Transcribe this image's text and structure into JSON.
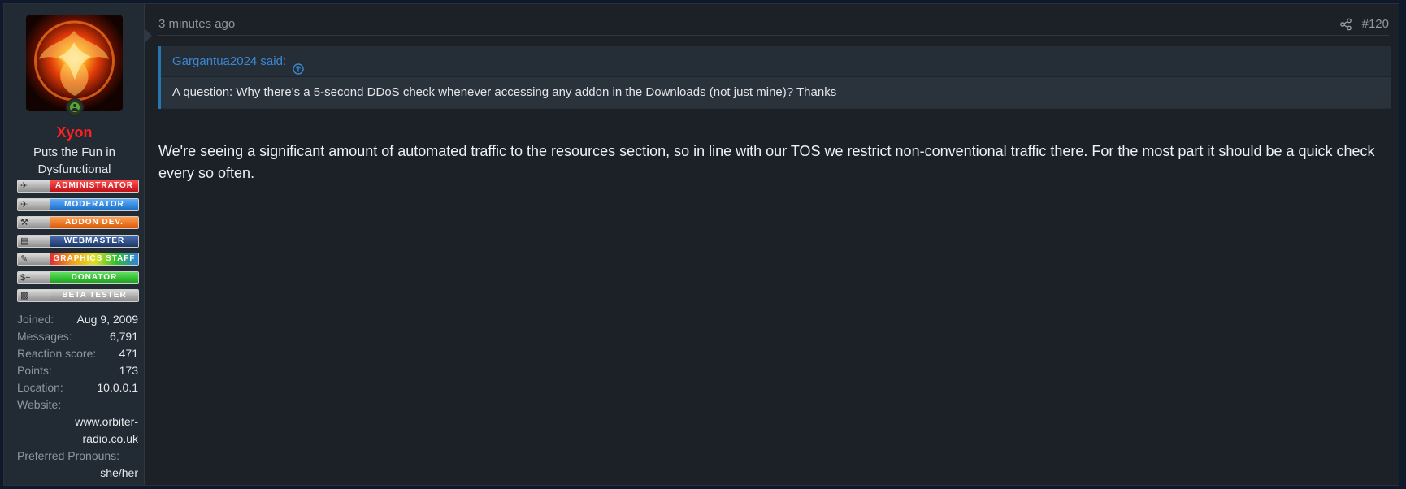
{
  "author": {
    "name": "Xyon",
    "title": "Puts the Fun in Dysfunctional",
    "status": "online-icon"
  },
  "banners": [
    {
      "label": "ADMINISTRATOR",
      "color": "#e8202a",
      "icon": "wings-icon"
    },
    {
      "label": "MODERATOR",
      "color": "#2f8fe0",
      "icon": "wings-icon"
    },
    {
      "label": "ADDON DEV.",
      "color": "#f07a18",
      "icon": "wrench-icon"
    },
    {
      "label": "WEBMASTER",
      "color": "#2c4f8a",
      "icon": "server-icon"
    },
    {
      "label": "GRAPHICS STAFF",
      "color": "#e0a020",
      "icon": "pencil-icon"
    },
    {
      "label": "DONATOR",
      "color": "#2cb82c",
      "icon": "dollar-icon"
    },
    {
      "label": "BETA TESTER",
      "color": "#a8a8a8",
      "icon": "chip-icon"
    }
  ],
  "stats": {
    "joined_label": "Joined:",
    "joined": "Aug 9, 2009",
    "messages_label": "Messages:",
    "messages": "6,791",
    "reaction_label": "Reaction score:",
    "reaction": "471",
    "points_label": "Points:",
    "points": "173",
    "location_label": "Location:",
    "location": "10.0.0.1",
    "website_label": "Website:",
    "website": "www.orbiter-radio.co.uk",
    "pronouns_label": "Preferred Pronouns:",
    "pronouns": "she/her"
  },
  "post": {
    "time": "3 minutes ago",
    "number": "#120",
    "quote_author": "Gargantua2024 said:",
    "quote_text": "A question: Why there's a 5-second DDoS check whenever accessing any addon in the Downloads (not just mine)? Thanks",
    "message": "We're seeing a significant amount of automated traffic to the resources section, so in line with our TOS we restrict non-conventional traffic there. For the most part it should be a quick check every so often."
  }
}
